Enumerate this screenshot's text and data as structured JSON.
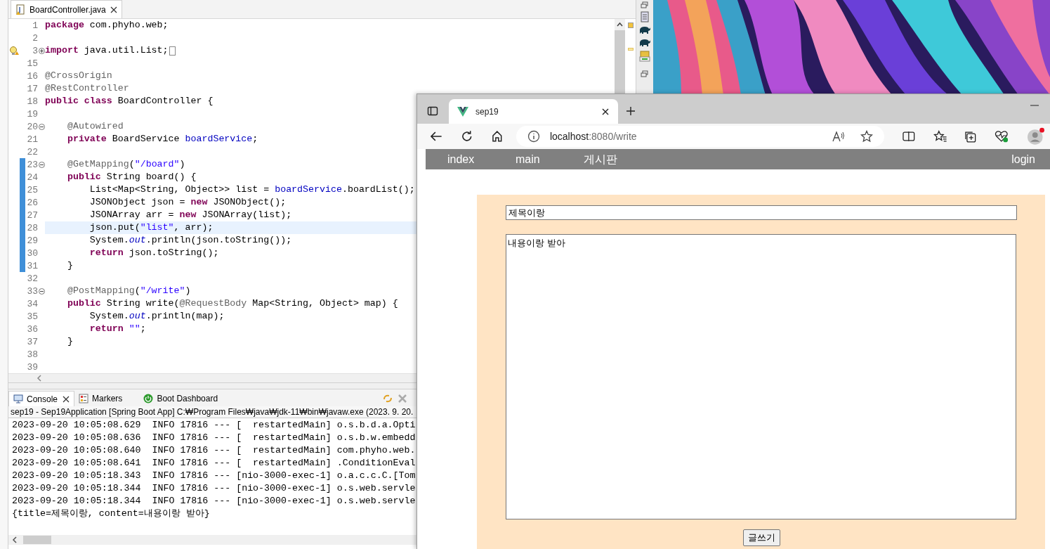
{
  "editor": {
    "tab": {
      "title": "BoardController.java",
      "selected": true
    },
    "lines": [
      {
        "number": "1",
        "changed": false,
        "current": false,
        "segments": [
          {
            "kind": "kw",
            "text": "package"
          },
          {
            "kind": "plain",
            "text": " com.phyho.web;"
          }
        ]
      },
      {
        "number": "2",
        "changed": false,
        "current": false
      },
      {
        "number": "3",
        "changed": false,
        "current": false,
        "fold": {
          "kind": "expand"
        },
        "marker": {
          "kind": "warning"
        },
        "segments": [
          {
            "kind": "kw",
            "text": "import"
          },
          {
            "kind": "plain",
            "text": " java.util.List;"
          },
          {
            "kind": "fold-box"
          }
        ]
      },
      {
        "number": "15",
        "changed": false,
        "current": false
      },
      {
        "number": "16",
        "changed": false,
        "current": false,
        "segments": [
          {
            "kind": "ann",
            "text": "@CrossOrigin"
          }
        ]
      },
      {
        "number": "17",
        "changed": false,
        "current": false,
        "segments": [
          {
            "kind": "ann",
            "text": "@RestController"
          }
        ]
      },
      {
        "number": "18",
        "changed": false,
        "current": false,
        "segments": [
          {
            "kind": "kw",
            "text": "public"
          },
          {
            "kind": "kw",
            "text": " class"
          },
          {
            "kind": "plain",
            "text": " BoardController {"
          }
        ]
      },
      {
        "number": "19",
        "changed": false,
        "current": false
      },
      {
        "number": "20",
        "changed": false,
        "current": false,
        "fold": {
          "kind": "collapse"
        },
        "segments": [
          {
            "kind": "ann",
            "text": "    @Autowired"
          }
        ]
      },
      {
        "number": "21",
        "changed": false,
        "current": false,
        "segments": [
          {
            "kind": "kw",
            "text": "    private"
          },
          {
            "kind": "plain",
            "text": " BoardService "
          },
          {
            "kind": "field",
            "text": "boardService"
          },
          {
            "kind": "plain",
            "text": ";"
          }
        ]
      },
      {
        "number": "22",
        "changed": false,
        "current": false
      },
      {
        "number": "23",
        "changed": true,
        "current": false,
        "fold": {
          "kind": "collapse"
        },
        "segments": [
          {
            "kind": "ann",
            "text": "    @GetMapping"
          },
          {
            "kind": "plain",
            "text": "("
          },
          {
            "kind": "str",
            "text": "\"/board\""
          },
          {
            "kind": "plain",
            "text": ")"
          }
        ]
      },
      {
        "number": "24",
        "changed": true,
        "current": false,
        "segments": [
          {
            "kind": "kw",
            "text": "    public"
          },
          {
            "kind": "plain",
            "text": " String board() {"
          }
        ]
      },
      {
        "number": "25",
        "changed": true,
        "current": false,
        "segments": [
          {
            "kind": "plain",
            "text": "        List<Map<String, Object>> list = "
          },
          {
            "kind": "field",
            "text": "boardService"
          },
          {
            "kind": "plain",
            "text": ".boardList();"
          }
        ]
      },
      {
        "number": "26",
        "changed": true,
        "current": false,
        "segments": [
          {
            "kind": "plain",
            "text": "        JSONObject json = "
          },
          {
            "kind": "kw",
            "text": "new"
          },
          {
            "kind": "plain",
            "text": " JSONObject();"
          }
        ]
      },
      {
        "number": "27",
        "changed": true,
        "current": false,
        "segments": [
          {
            "kind": "plain",
            "text": "        JSONArray arr = "
          },
          {
            "kind": "kw",
            "text": "new"
          },
          {
            "kind": "plain",
            "text": " JSONArray(list);"
          }
        ]
      },
      {
        "number": "28",
        "changed": true,
        "current": true,
        "segments": [
          {
            "kind": "plain",
            "text": "        json.put("
          },
          {
            "kind": "str",
            "text": "\"list\""
          },
          {
            "kind": "plain",
            "text": ", arr);"
          }
        ]
      },
      {
        "number": "29",
        "changed": true,
        "current": false,
        "segments": [
          {
            "kind": "plain",
            "text": "        System."
          },
          {
            "kind": "static",
            "text": "out"
          },
          {
            "kind": "plain",
            "text": ".println(json.toString());"
          }
        ]
      },
      {
        "number": "30",
        "changed": true,
        "current": false,
        "segments": [
          {
            "kind": "kw",
            "text": "        return"
          },
          {
            "kind": "plain",
            "text": " json.toString();"
          }
        ]
      },
      {
        "number": "31",
        "changed": true,
        "current": false,
        "segments": [
          {
            "kind": "plain",
            "text": "    }"
          }
        ]
      },
      {
        "number": "32",
        "changed": false,
        "current": false
      },
      {
        "number": "33",
        "changed": false,
        "current": false,
        "fold": {
          "kind": "collapse"
        },
        "segments": [
          {
            "kind": "ann",
            "text": "    @PostMapping"
          },
          {
            "kind": "plain",
            "text": "("
          },
          {
            "kind": "str",
            "text": "\"/write\""
          },
          {
            "kind": "plain",
            "text": ")"
          }
        ]
      },
      {
        "number": "34",
        "changed": false,
        "current": false,
        "segments": [
          {
            "kind": "kw",
            "text": "    public"
          },
          {
            "kind": "plain",
            "text": " String write("
          },
          {
            "kind": "ann",
            "text": "@RequestBody"
          },
          {
            "kind": "plain",
            "text": " Map<String, Object> map) {"
          }
        ]
      },
      {
        "number": "35",
        "changed": false,
        "current": false,
        "segments": [
          {
            "kind": "plain",
            "text": "        System."
          },
          {
            "kind": "static",
            "text": "out"
          },
          {
            "kind": "plain",
            "text": ".println(map);"
          }
        ]
      },
      {
        "number": "36",
        "changed": false,
        "current": false,
        "segments": [
          {
            "kind": "kw",
            "text": "        return"
          },
          {
            "kind": "str",
            "text": " \"\""
          },
          {
            "kind": "plain",
            "text": ";"
          }
        ]
      },
      {
        "number": "37",
        "changed": false,
        "current": false,
        "segments": [
          {
            "kind": "plain",
            "text": "    }"
          }
        ]
      },
      {
        "number": "38",
        "changed": false,
        "current": false
      },
      {
        "number": "39",
        "changed": false,
        "current": false
      }
    ]
  },
  "console": {
    "tabs": [
      {
        "label": "Console",
        "selected": true
      },
      {
        "label": "Markers",
        "selected": false
      },
      {
        "label": "Boot Dashboard",
        "selected": false
      }
    ],
    "header": "sep19 - Sep19Application [Spring Boot App] C:₩Program Files₩java₩jdk-11₩bin₩javaw.exe  (2023. 9. 20.",
    "lines": [
      "2023-09-20 10:05:08.629  INFO 17816 --- [  restartedMain] o.s.b.d.a.Opti",
      "2023-09-20 10:05:08.636  INFO 17816 --- [  restartedMain] o.s.b.w.embedd",
      "2023-09-20 10:05:08.640  INFO 17816 --- [  restartedMain] com.phyho.web.",
      "2023-09-20 10:05:08.641  INFO 17816 --- [  restartedMain] .ConditionEval",
      "2023-09-20 10:05:18.343  INFO 17816 --- [nio-3000-exec-1] o.a.c.c.C.[Tom",
      "2023-09-20 10:05:18.344  INFO 17816 --- [nio-3000-exec-1] o.s.web.servle",
      "2023-09-20 10:05:18.344  INFO 17816 --- [nio-3000-exec-1] o.s.web.servle",
      "{title=제목이랑, content=내용이랑 받아}"
    ]
  },
  "browser": {
    "tab": {
      "title": "sep19",
      "selected": true
    },
    "url": {
      "host": "localhost",
      "path": ":8080/write"
    },
    "nav": [
      {
        "label": "index",
        "kind": "start"
      },
      {
        "label": "main",
        "kind": "start"
      },
      {
        "label": "게시판",
        "kind": "start"
      },
      {
        "label": "login",
        "kind": "end"
      }
    ],
    "form": {
      "title_value": "제목이랑",
      "content_value": "내용이랑 받아",
      "submit": "글쓰기"
    }
  }
}
